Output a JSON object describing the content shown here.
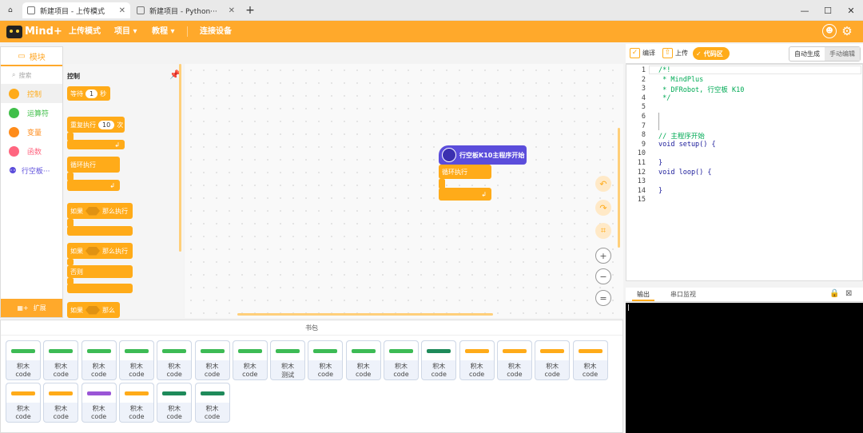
{
  "tabs": [
    {
      "label": "新建项目 - 上传模式"
    },
    {
      "label": "新建项目 - Python···"
    }
  ],
  "window": {
    "new_tab": "+",
    "minimize": "—",
    "maximize": "☐",
    "close": "✕"
  },
  "menu": {
    "logo": "Mind+",
    "upload_mode": "上传模式",
    "project": "项目 ▾",
    "tutorial": "教程 ▾",
    "connect": "连接设备"
  },
  "categories": {
    "header": "模块",
    "search_placeholder": "搜索",
    "items": [
      {
        "label": "控制",
        "color": "#ffab19"
      },
      {
        "label": "运算符",
        "color": "#40bf4a"
      },
      {
        "label": "变量",
        "color": "#ff8c1a"
      },
      {
        "label": "函数",
        "color": "#ff6680"
      },
      {
        "label": "行空板···",
        "color": "#5b4ddb"
      }
    ],
    "extension": "扩展"
  },
  "palette": {
    "section": "控制",
    "wait": "等待",
    "wait_value": "1",
    "sec": "秒",
    "repeat": "重复执行",
    "repeat_value": "10",
    "times": "次",
    "forever": "循环执行",
    "if": "如果",
    "then": "那么执行",
    "else": "否则",
    "if2": "那么"
  },
  "workspace": {
    "hat_label": "行空板K10主程序开始",
    "loop_label": "循环执行"
  },
  "backpack": {
    "title": "书包",
    "items": [
      {
        "l1": "积木",
        "l2": "code",
        "c": "#3dbb55"
      },
      {
        "l1": "积木",
        "l2": "code",
        "c": "#3dbb55"
      },
      {
        "l1": "积木",
        "l2": "code",
        "c": "#3dbb55"
      },
      {
        "l1": "积木",
        "l2": "code",
        "c": "#3dbb55"
      },
      {
        "l1": "积木",
        "l2": "code",
        "c": "#3dbb55"
      },
      {
        "l1": "积木",
        "l2": "code",
        "c": "#3dbb55"
      },
      {
        "l1": "积木",
        "l2": "code",
        "c": "#3dbb55"
      },
      {
        "l1": "积木",
        "l2": "测试",
        "c": "#3dbb55"
      },
      {
        "l1": "积木",
        "l2": "code",
        "c": "#3dbb55"
      },
      {
        "l1": "积木",
        "l2": "code",
        "c": "#3dbb55"
      },
      {
        "l1": "积木",
        "l2": "code",
        "c": "#3dbb55"
      },
      {
        "l1": "积木",
        "l2": "code",
        "c": "#1e8a5a"
      },
      {
        "l1": "积木",
        "l2": "code",
        "c": "#ffab19"
      },
      {
        "l1": "积木",
        "l2": "code",
        "c": "#ffab19"
      },
      {
        "l1": "积木",
        "l2": "code",
        "c": "#ffab19"
      },
      {
        "l1": "积木",
        "l2": "code",
        "c": "#ffab19"
      },
      {
        "l1": "积木",
        "l2": "code",
        "c": "#ffab19"
      },
      {
        "l1": "积木",
        "l2": "code",
        "c": "#ffab19"
      },
      {
        "l1": "积木",
        "l2": "code",
        "c": "#9a55d6"
      },
      {
        "l1": "积木",
        "l2": "code",
        "c": "#ffab19"
      },
      {
        "l1": "积木",
        "l2": "code",
        "c": "#1e8a5a"
      },
      {
        "l1": "积木",
        "l2": "code",
        "c": "#1e8a5a"
      }
    ]
  },
  "code_toolbar": {
    "compile": "编译",
    "upload": "上传",
    "code_area": "代码区",
    "auto": "自动生成",
    "manual": "手动编辑"
  },
  "code_lines": [
    "/*!",
    " * MindPlus",
    " * DFRobot, 行空板 K10",
    " */",
    "",
    "",
    "",
    "// 主程序开始",
    "void setup() {",
    "",
    "}",
    "void loop() {",
    "",
    "}",
    ""
  ],
  "output": {
    "tab_output": "输出",
    "tab_serial": "串口监视"
  }
}
